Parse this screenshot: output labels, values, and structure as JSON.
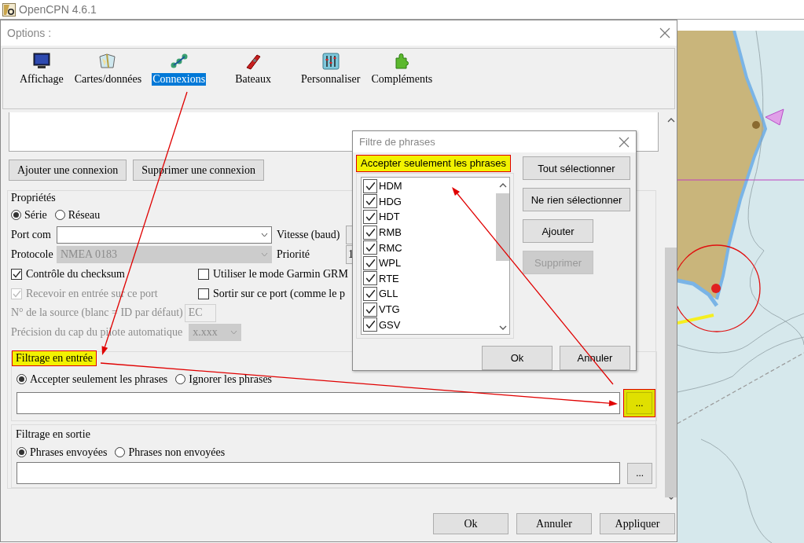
{
  "app": {
    "title": "OpenCPN 4.6.1"
  },
  "options_dialog": {
    "title": "Options :",
    "categories": [
      {
        "label": "Affichage",
        "selected": false
      },
      {
        "label": "Cartes/données",
        "selected": false
      },
      {
        "label": "Connexions",
        "selected": true
      },
      {
        "label": "Bateaux",
        "selected": false
      },
      {
        "label": "Personnaliser",
        "selected": false
      },
      {
        "label": "Compléments",
        "selected": false
      }
    ],
    "connection_buttons": [
      "Ajouter une connexion",
      "Supprimer une connexion"
    ],
    "properties": {
      "title": "Propriétés",
      "connection_type": [
        {
          "label": "Série",
          "selected": true
        },
        {
          "label": "Réseau",
          "selected": false
        }
      ],
      "port_com": {
        "label": "Port com"
      },
      "baud_rate": {
        "label": "Vitesse (baud)"
      },
      "protocol": {
        "label": "Protocole",
        "value": "NMEA 0183",
        "disabled": true
      },
      "priority": {
        "label": "Priorité",
        "value": "1"
      },
      "checkboxes": [
        {
          "label": "Contrôle du checksum",
          "checked": true,
          "disabled": false
        },
        {
          "label": "Utiliser le mode Garmin GRM",
          "checked": false,
          "disabled": false
        },
        {
          "label": "Recevoir en entrée sur ce port",
          "checked": true,
          "disabled": true
        },
        {
          "label": "Sortir sur ce port (comme le p",
          "checked": false,
          "disabled": false
        }
      ],
      "source_id": {
        "label": "N° de la source (blanc = ID par défaut)",
        "value": "EC",
        "disabled": true
      },
      "autopilot_precision": {
        "label": "Précision du cap du pilote automatique",
        "value": "x.xxx",
        "disabled": true
      },
      "input_filter": {
        "title": "Filtrage en entrée",
        "highlighted": true,
        "options": [
          {
            "label": "Accepter seulement les phrases",
            "selected": true
          },
          {
            "label": "Ignorer les phrases",
            "selected": false
          }
        ],
        "button": {
          "label": "...",
          "highlighted": true
        }
      },
      "output_filter": {
        "title": "Filtrage en sortie",
        "highlighted": false,
        "options": [
          {
            "label": "Phrases envoyées",
            "selected": true
          },
          {
            "label": "Phrases non envoyées",
            "selected": false
          }
        ],
        "button": {
          "label": "...",
          "highlighted": false
        }
      }
    },
    "footer_buttons": [
      "Ok",
      "Annuler",
      "Appliquer"
    ]
  },
  "sentence_filter_dialog": {
    "title": "Filtre de phrases",
    "heading": {
      "text": "Accepter seulement les phrases",
      "highlighted": true
    },
    "sentences": [
      {
        "label": "HDM",
        "checked": true
      },
      {
        "label": "HDG",
        "checked": true
      },
      {
        "label": "HDT",
        "checked": true
      },
      {
        "label": "RMB",
        "checked": true
      },
      {
        "label": "RMC",
        "checked": true
      },
      {
        "label": "WPL",
        "checked": true
      },
      {
        "label": "RTE",
        "checked": true
      },
      {
        "label": "GLL",
        "checked": true
      },
      {
        "label": "VTG",
        "checked": true
      },
      {
        "label": "GSV",
        "checked": true
      }
    ],
    "side_buttons": [
      {
        "label": "Tout sélectionner",
        "disabled": false,
        "kind": "wide"
      },
      {
        "label": "Ne rien sélectionner",
        "disabled": false,
        "kind": "wide"
      },
      {
        "label": "Ajouter",
        "disabled": false,
        "kind": "narrow"
      },
      {
        "label": "Supprimer",
        "disabled": true,
        "kind": "narrow"
      }
    ],
    "footer_buttons": [
      "Ok",
      "Annuler"
    ]
  }
}
